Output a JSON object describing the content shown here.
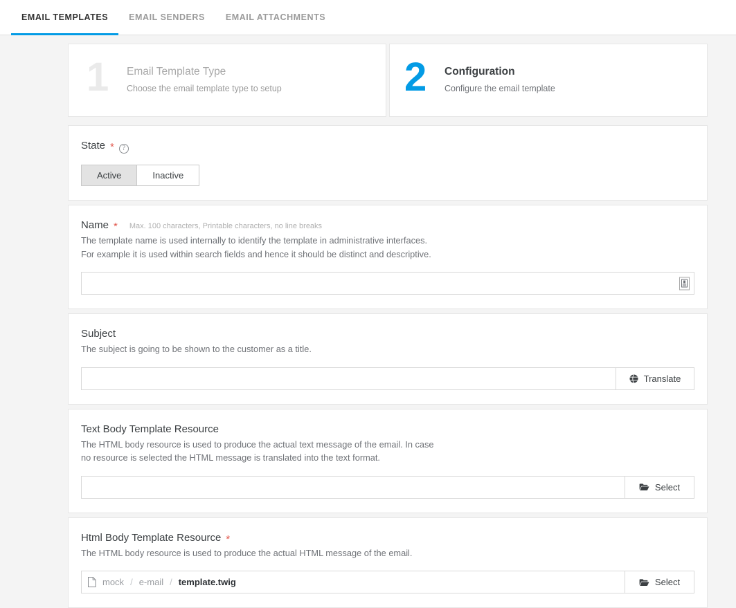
{
  "colors": {
    "accent": "#039be5",
    "required": "#e2574c",
    "page_bg": "#f4f4f4",
    "card_bg": "#ffffff",
    "border": "#e6e6e6",
    "step1_num": "#eaeaea"
  },
  "tabs": [
    {
      "label": "EMAIL TEMPLATES",
      "active": true
    },
    {
      "label": "EMAIL SENDERS",
      "active": false
    },
    {
      "label": "EMAIL ATTACHMENTS",
      "active": false
    }
  ],
  "steps": [
    {
      "number": "1",
      "title": "Email Template Type",
      "subtitle": "Choose the email template type to setup",
      "state": "inactive"
    },
    {
      "number": "2",
      "title": "Configuration",
      "subtitle": "Configure the email template",
      "state": "active"
    }
  ],
  "fields": {
    "state": {
      "label": "State",
      "required_marker": "*",
      "help_glyph": "?",
      "options": [
        {
          "label": "Active",
          "selected": true
        },
        {
          "label": "Inactive",
          "selected": false
        }
      ]
    },
    "name": {
      "label": "Name",
      "required_marker": "*",
      "constraints": "Max. 100 characters, Printable characters, no line breaks",
      "description_line1": "The template name is used internally to identify the template in administrative interfaces.",
      "description_line2": "For example it is used within search fields and hence it should be distinct and descriptive.",
      "value": "",
      "placeholder": "",
      "icon": "id-card-icon"
    },
    "subject": {
      "label": "Subject",
      "description_line1": "The subject is going to be shown to the customer as a title.",
      "value": "",
      "placeholder": "",
      "button_label": "Translate",
      "button_icon": "globe-icon"
    },
    "text_body": {
      "label": "Text Body Template Resource",
      "description_line1": "The HTML body resource is used to produce the actual text message of the email. In case",
      "description_line2": "no resource is selected the HTML message is translated into the text format.",
      "value": "",
      "placeholder": "",
      "button_label": "Select",
      "button_icon": "folder-open-icon"
    },
    "html_body": {
      "label": "Html Body Template Resource",
      "required_marker": "*",
      "description_line1": "The HTML body resource is used to produce the actual HTML message of the email.",
      "path": {
        "icon": "file-icon",
        "segments": [
          "mock",
          "e-mail",
          "template.twig"
        ],
        "separator": "/"
      },
      "button_label": "Select",
      "button_icon": "folder-open-icon"
    }
  }
}
